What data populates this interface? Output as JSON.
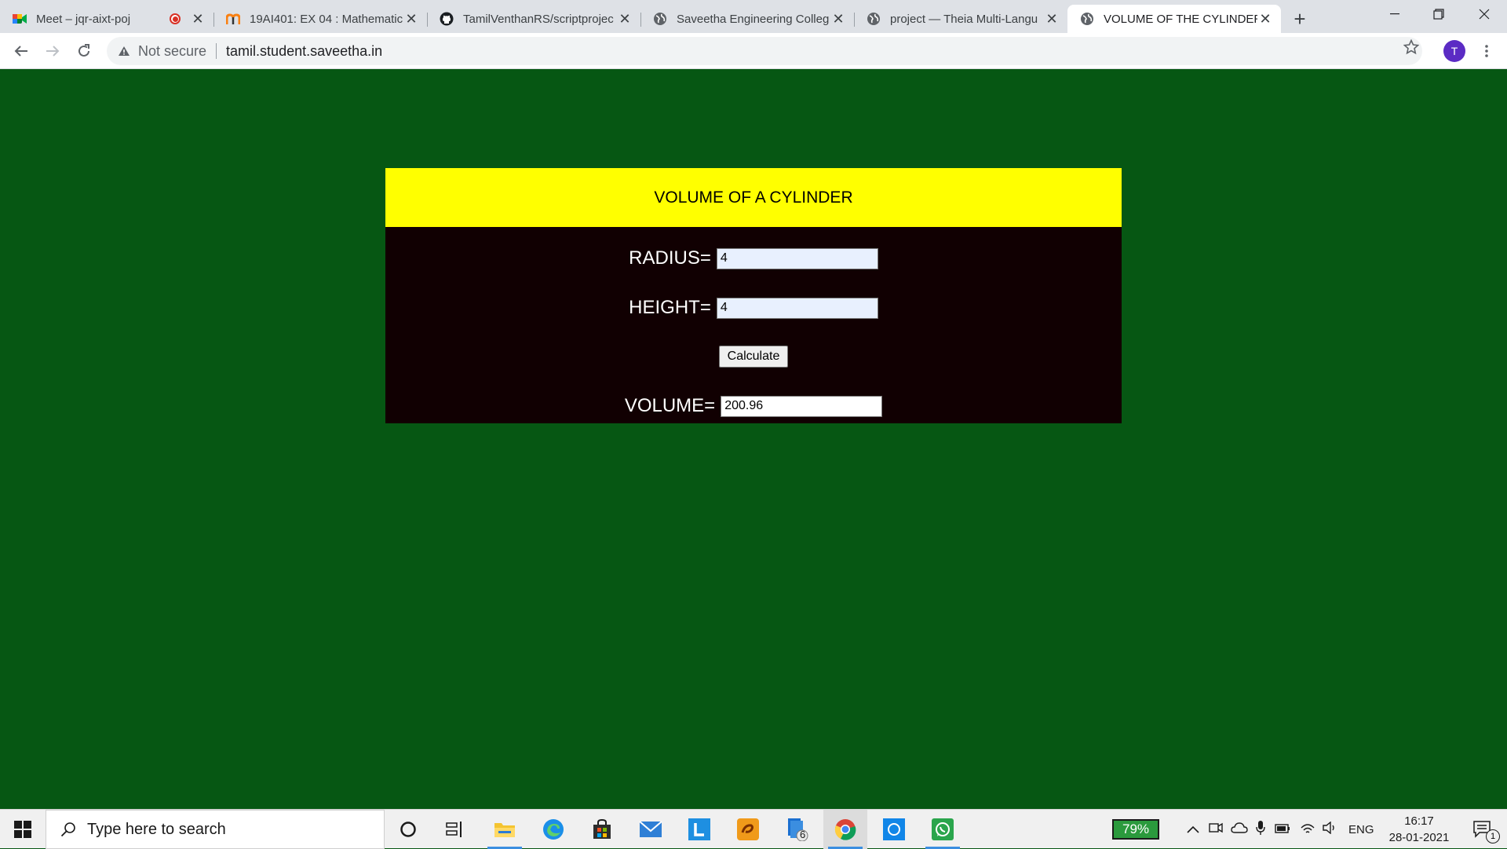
{
  "browser": {
    "tabs": [
      {
        "title": "Meet – jqr-aixt-poj",
        "favicon": "google-meet-icon",
        "recording": true
      },
      {
        "title": "19AI401: EX 04 : Mathematic",
        "favicon": "moodle-icon"
      },
      {
        "title": "TamilVenthanRS/scriptprojec",
        "favicon": "github-icon"
      },
      {
        "title": "Saveetha Engineering Colleg",
        "favicon": "globe-icon"
      },
      {
        "title": "project — Theia Multi-Langu",
        "favicon": "globe-icon"
      },
      {
        "title": "VOLUME OF THE CYLINDER",
        "favicon": "globe-icon",
        "active": true
      }
    ],
    "security_label": "Not secure",
    "url": "tamil.student.saveetha.in",
    "profile_initial": "T"
  },
  "page": {
    "background_color": "#065713",
    "header": {
      "title": "VOLUME OF A CYLINDER",
      "color": "#ffff00"
    },
    "form": {
      "radius_label": "RADIUS=",
      "radius_value": "4",
      "height_label": "HEIGHT=",
      "height_value": "4",
      "calculate_label": "Calculate",
      "volume_label": "VOLUME=",
      "volume_value": "200.96"
    }
  },
  "taskbar": {
    "search_placeholder": "Type here to search",
    "battery": "79%",
    "language": "ENG",
    "time": "16:17",
    "date": "28-01-2021",
    "file_explorer_badge": "6",
    "notification_count": "1"
  }
}
